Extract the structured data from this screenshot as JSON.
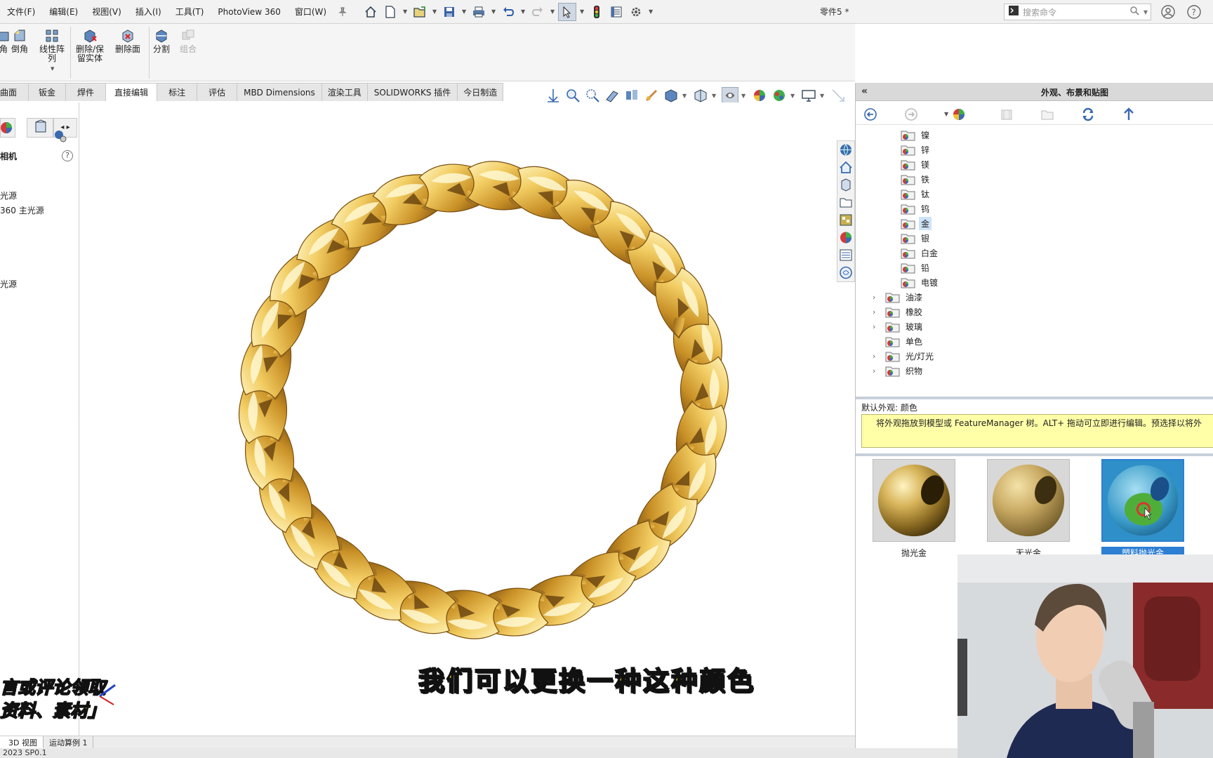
{
  "menu": {
    "items": [
      "文件(F)",
      "编辑(E)",
      "视图(V)",
      "插入(I)",
      "工具(T)",
      "PhotoView 360",
      "窗口(W)"
    ],
    "document_title": "零件5 *",
    "search_placeholder": "搜索命令"
  },
  "ribbon": {
    "chamfer": "倒角",
    "linear_pattern": "线性阵\n列",
    "delete_keep_body": "删除/保\n留实体",
    "delete_face": "删除面",
    "split": "分割",
    "combine": "组合"
  },
  "tabs": [
    "曲面",
    "钣金",
    "焊件",
    "直接编辑",
    "标注",
    "评估",
    "MBD Dimensions",
    "渲染工具",
    "SOLIDWORKS 插件",
    "今日制造"
  ],
  "active_tab": "直接编辑",
  "left_panel": {
    "camera": "相机",
    "light_1": "光源",
    "light_2": "360 主光源",
    "light_3": "光源"
  },
  "task_pane": {
    "title": "外观、布景和贴图",
    "collapse": "«",
    "tree": [
      {
        "label": "镍",
        "level": 2,
        "expandable": false
      },
      {
        "label": "锌",
        "level": 2,
        "expandable": false
      },
      {
        "label": "镁",
        "level": 2,
        "expandable": false
      },
      {
        "label": "铁",
        "level": 2,
        "expandable": false
      },
      {
        "label": "钛",
        "level": 2,
        "expandable": false
      },
      {
        "label": "钨",
        "level": 2,
        "expandable": false
      },
      {
        "label": "金",
        "level": 2,
        "expandable": false,
        "selected": true
      },
      {
        "label": "银",
        "level": 2,
        "expandable": false
      },
      {
        "label": "白金",
        "level": 2,
        "expandable": false
      },
      {
        "label": "铅",
        "level": 2,
        "expandable": false
      },
      {
        "label": "电镀",
        "level": 2,
        "expandable": false
      },
      {
        "label": "油漆",
        "level": 1,
        "expandable": true
      },
      {
        "label": "橡胶",
        "level": 1,
        "expandable": true
      },
      {
        "label": "玻璃",
        "level": 1,
        "expandable": true
      },
      {
        "label": "单色",
        "level": 1,
        "expandable": false
      },
      {
        "label": "光/灯光",
        "level": 1,
        "expandable": true
      },
      {
        "label": "织物",
        "level": 1,
        "expandable": true
      }
    ],
    "info_label": "默认外观: 颜色",
    "tip": "将外观拖放到模型或 FeatureManager 树。ALT+ 拖动可立即进行编辑。预选择以将外",
    "swatches": [
      {
        "label": "抛光金",
        "selected": false
      },
      {
        "label": "无光金",
        "selected": false
      },
      {
        "label": "塑料抛光金",
        "selected": true
      }
    ]
  },
  "viewport": {
    "subtitle": "我们可以更换一种这种颜色",
    "promo_line_1": "言或评论领取",
    "promo_line_2": "资料、素材」"
  },
  "bottom_tabs": [
    "3D 视图",
    "运动算例 1"
  ],
  "status": "2023 SP0.1",
  "colors": {
    "gold_light": "#fff1a8",
    "gold_mid": "#e7b948",
    "gold_dark": "#8a5a12",
    "selection_blue": "#2d7fd4",
    "tip_yellow": "#ffffa8",
    "subtitle_yellow": "#ffe11a"
  }
}
